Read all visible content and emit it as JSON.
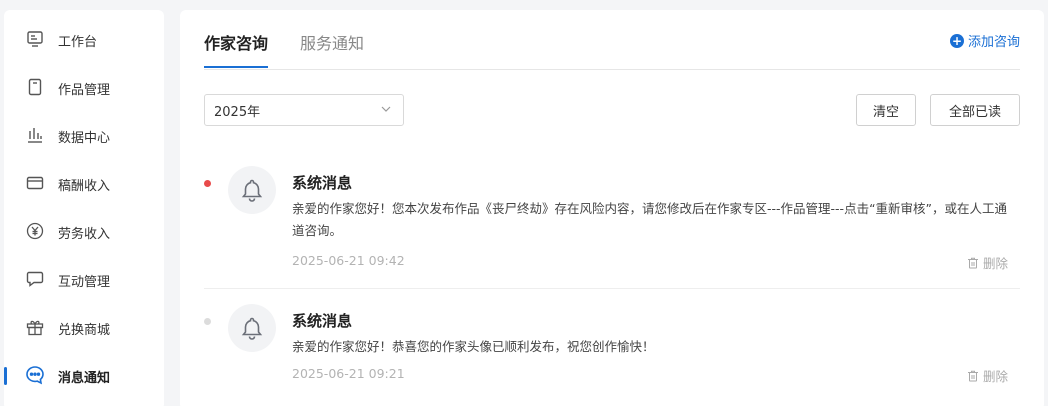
{
  "sidebar": {
    "items": [
      {
        "label": "工作台",
        "icon": "monitor-icon"
      },
      {
        "label": "作品管理",
        "icon": "book-icon"
      },
      {
        "label": "数据中心",
        "icon": "bar-chart-icon"
      },
      {
        "label": "稿酬收入",
        "icon": "card-icon"
      },
      {
        "label": "劳务收入",
        "icon": "yen-coin-icon"
      },
      {
        "label": "互动管理",
        "icon": "chat-bubble-icon"
      },
      {
        "label": "兑换商城",
        "icon": "gift-icon"
      },
      {
        "label": "消息通知",
        "icon": "message-dots-icon"
      }
    ],
    "active_index": 7
  },
  "tabs": [
    {
      "label": "作家咨询",
      "active": true
    },
    {
      "label": "服务通知",
      "active": false
    }
  ],
  "add_consult": {
    "label": "添加咨询",
    "icon": "plus-circle-icon"
  },
  "year_filter": {
    "value": "2025年"
  },
  "toolbar": {
    "clear_label": "清空",
    "mark_all_read_label": "全部已读"
  },
  "messages": [
    {
      "title": "系统消息",
      "body": "亲爱的作家您好！您本次发布作品《丧尸终劫》存在风险内容，请您修改后在作家专区---作品管理---点击“重新审核”，或在人工通道咨询。",
      "time": "2025-06-21 09:42",
      "unread": true,
      "delete_label": "删除"
    },
    {
      "title": "系统消息",
      "body": "亲爱的作家您好！恭喜您的作家头像已顺利发布，祝您创作愉快！",
      "time": "2025-06-21 09:21",
      "unread": false,
      "delete_label": "删除"
    }
  ],
  "colors": {
    "accent": "#1a6fd4",
    "unread_dot": "#e84a4a"
  }
}
